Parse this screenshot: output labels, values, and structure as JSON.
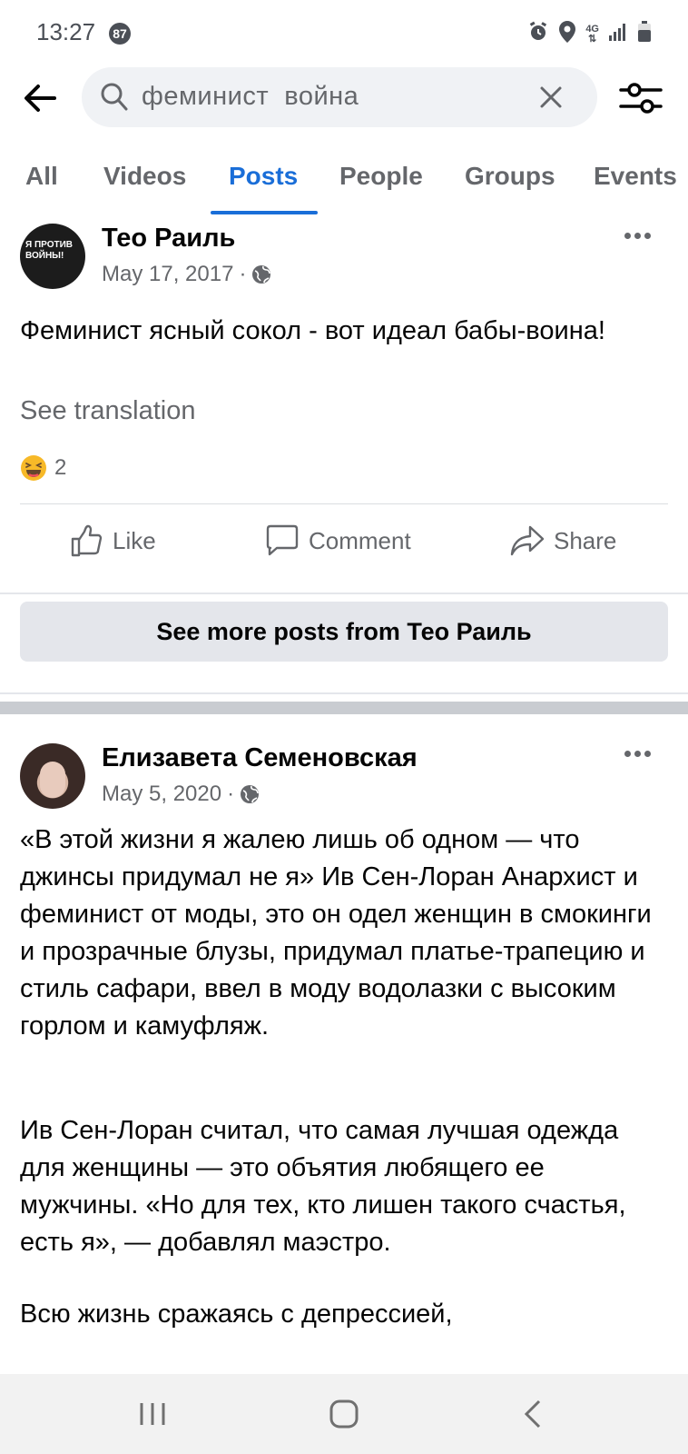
{
  "status_bar": {
    "time": "13:27",
    "notification_count": "87",
    "icons": [
      "alarm-icon",
      "location-icon",
      "4g-icon",
      "signal-icon",
      "battery-icon"
    ],
    "network": "4G"
  },
  "search": {
    "query": "феминист  война",
    "icons": {
      "back": "arrow-left-icon",
      "search": "search-icon",
      "clear": "close-icon",
      "filter": "filter-sliders-icon"
    }
  },
  "tabs": [
    {
      "label": "All",
      "active": false
    },
    {
      "label": "Videos",
      "active": false
    },
    {
      "label": "Posts",
      "active": true
    },
    {
      "label": "People",
      "active": false
    },
    {
      "label": "Groups",
      "active": false
    },
    {
      "label": "Events",
      "active": false
    }
  ],
  "posts": [
    {
      "author": "Тео Раиль",
      "avatar_text": "Я ПРОТИВ ВОЙНЫ!",
      "date": "May 17, 2017",
      "separator": "·",
      "privacy_icon": "globe-icon",
      "text": "Феминист ясный сокол - вот идеал бабы-воина!",
      "see_translation": "See translation",
      "reaction_icon": "haha-emoji-icon",
      "reaction_count": "2",
      "actions": {
        "like": "Like",
        "comment": "Comment",
        "share": "Share"
      },
      "see_more": "See more posts from Тео Раиль"
    },
    {
      "author": "Елизавета Семеновская",
      "date": "May 5, 2020",
      "separator": "·",
      "privacy_icon": "globe-icon",
      "paragraphs": [
        "«В этой жизни я жалею лишь об одном — что джинсы придумал не я» Ив Сен-Лоран Анархист и феминист от моды, это он одел женщин в смокинги и прозрачные блузы, придумал платье-трапецию и стиль сафари, ввел в моду водолазки с высоким горлом и камуфляж.",
        "Ив Сен-Лоран считал, что самая лучшая одежда для женщины — это объятия любящего ее мужчины. «Но для тех, кто лишен такого счастья, есть я», — добавлял маэстро.",
        "Всю жизнь сражаясь с депрессией,"
      ]
    }
  ],
  "nav_bar": {
    "icons": [
      "recents-icon",
      "home-icon",
      "back-icon"
    ]
  },
  "colors": {
    "accent": "#1a6ed8",
    "secondary_text": "#65676b",
    "button_bg": "#e4e6eb",
    "search_bg": "#f0f2f5"
  }
}
